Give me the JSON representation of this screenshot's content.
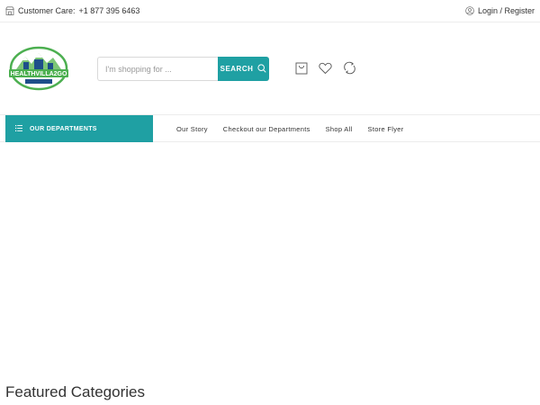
{
  "topbar": {
    "customer_care_label": "Customer Care:",
    "customer_care_phone": "+1 877 395 6463",
    "login_label": "Login / Register"
  },
  "header": {
    "logo_text": "HEALTHVILLA2GO",
    "search_placeholder": "I'm shopping for ...",
    "search_value": "",
    "search_button": "SEARCH",
    "icons": [
      "shopping-bag-icon",
      "heart-icon",
      "compare-icon"
    ]
  },
  "nav": {
    "departments_label": "OUR DEPARTMENTS",
    "links": [
      "Our Story",
      "Checkout our Departments",
      "Shop All",
      "Store Flyer"
    ]
  },
  "main": {
    "featured_title": "Featured Categories"
  },
  "colors": {
    "accent": "#1fa0a3",
    "logo_green": "#4caf50",
    "logo_blue": "#1e4f8a"
  }
}
